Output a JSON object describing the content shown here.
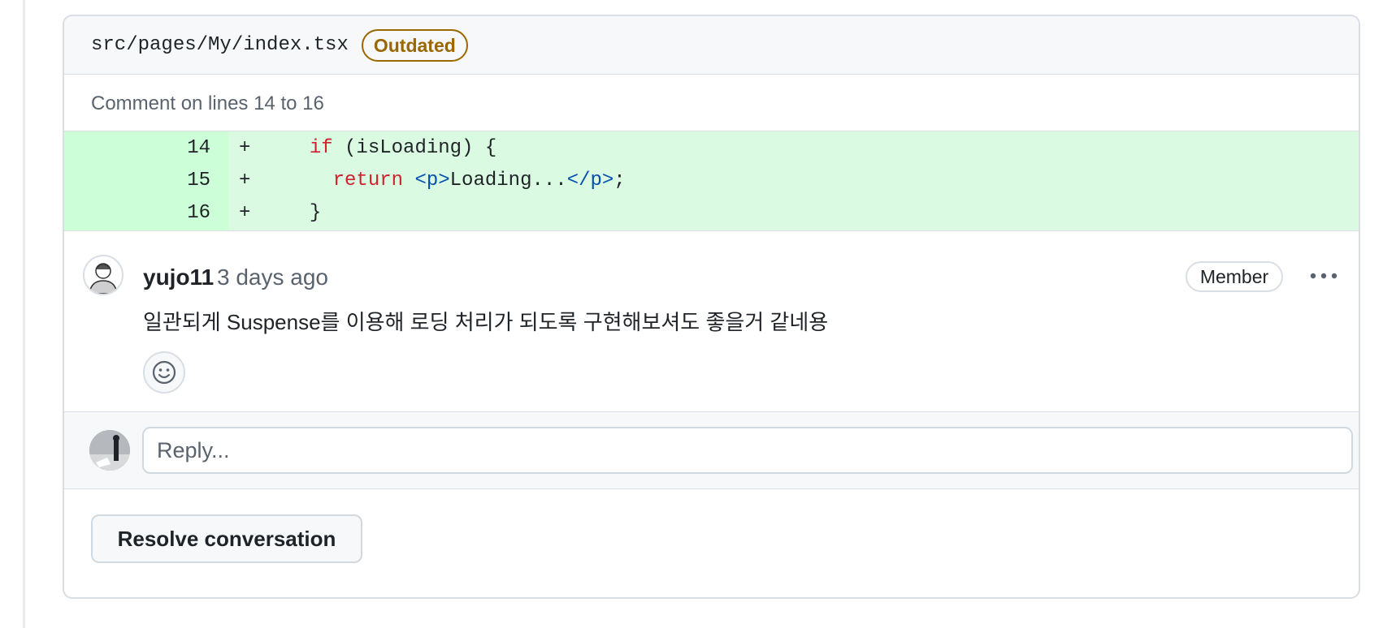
{
  "file": {
    "path": "src/pages/My/index.tsx",
    "badge": "Outdated"
  },
  "comment_range": "Comment on lines 14 to 16",
  "diff": {
    "lines": [
      {
        "number": "14",
        "sign": "+",
        "keyword": "if",
        "rest": " (isLoading) {",
        "indent": "  "
      },
      {
        "number": "15",
        "sign": "+",
        "keyword": "return",
        "tag_open": "<p>",
        "text": "Loading...",
        "tag_close": "</p>",
        "end": ";",
        "indent": "    "
      },
      {
        "number": "16",
        "sign": "+",
        "rest": "}",
        "indent": "  "
      }
    ]
  },
  "comment": {
    "author": "yujo11",
    "timestamp": "3 days ago",
    "role_badge": "Member",
    "body": "일관되게 Suspense를 이용해 로딩 처리가 되도록 구현해보셔도 좋을거 같네용"
  },
  "reply": {
    "placeholder": "Reply..."
  },
  "actions": {
    "resolve_label": "Resolve conversation"
  },
  "colors": {
    "added_bg": "#dafbe1",
    "added_gutter": "#ccffd8",
    "outdated": "#9a6700",
    "keyword": "#cf222e",
    "tag": "#0550ae"
  },
  "icons": {
    "reaction": "smiley-icon",
    "more": "kebab-horizontal-icon"
  }
}
